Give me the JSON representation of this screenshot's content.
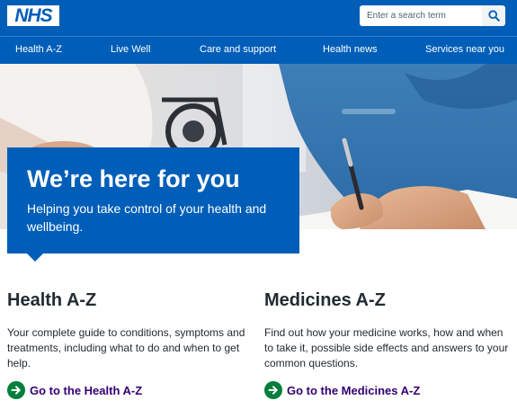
{
  "header": {
    "logo_text": "NHS",
    "search": {
      "placeholder": "Enter a search term"
    }
  },
  "nav": {
    "items": [
      {
        "label": "Health A-Z"
      },
      {
        "label": "Live Well"
      },
      {
        "label": "Care and support"
      },
      {
        "label": "Health news"
      },
      {
        "label": "Services near you"
      }
    ]
  },
  "hero": {
    "title": "We’re here for you",
    "subtitle": "Helping you take control of your health and wellbeing."
  },
  "sections": [
    {
      "title": "Health A-Z",
      "text": "Your complete guide to conditions, symptoms and treatments, including what to do and when to get help.",
      "link_label": "Go to the Health A-Z"
    },
    {
      "title": "Medicines A-Z",
      "text": "Find out how your medicine works, how and when to take it, possible side effects and answers to your common questions.",
      "link_label": "Go to the Medicines A-Z"
    }
  ],
  "colors": {
    "brand_blue": "#005eb8",
    "link_purple": "#330072",
    "cta_green": "#007f3b",
    "text": "#212b32"
  }
}
